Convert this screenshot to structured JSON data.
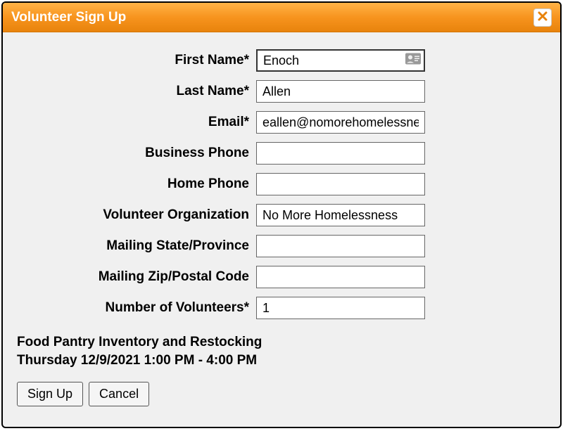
{
  "dialog": {
    "title": "Volunteer Sign Up"
  },
  "form": {
    "fields": [
      {
        "label": "First Name*",
        "value": "Enoch"
      },
      {
        "label": "Last Name*",
        "value": "Allen"
      },
      {
        "label": "Email*",
        "value": "eallen@nomorehomelessness.org"
      },
      {
        "label": "Business Phone",
        "value": ""
      },
      {
        "label": "Home Phone",
        "value": ""
      },
      {
        "label": "Volunteer Organization",
        "value": "No More Homelessness"
      },
      {
        "label": "Mailing State/Province",
        "value": ""
      },
      {
        "label": "Mailing Zip/Postal Code",
        "value": ""
      },
      {
        "label": "Number of Volunteers*",
        "value": "1"
      }
    ]
  },
  "event": {
    "title": "Food Pantry Inventory and Restocking",
    "datetime": "Thursday 12/9/2021 1:00 PM - 4:00 PM"
  },
  "buttons": {
    "signup": "Sign Up",
    "cancel": "Cancel"
  }
}
